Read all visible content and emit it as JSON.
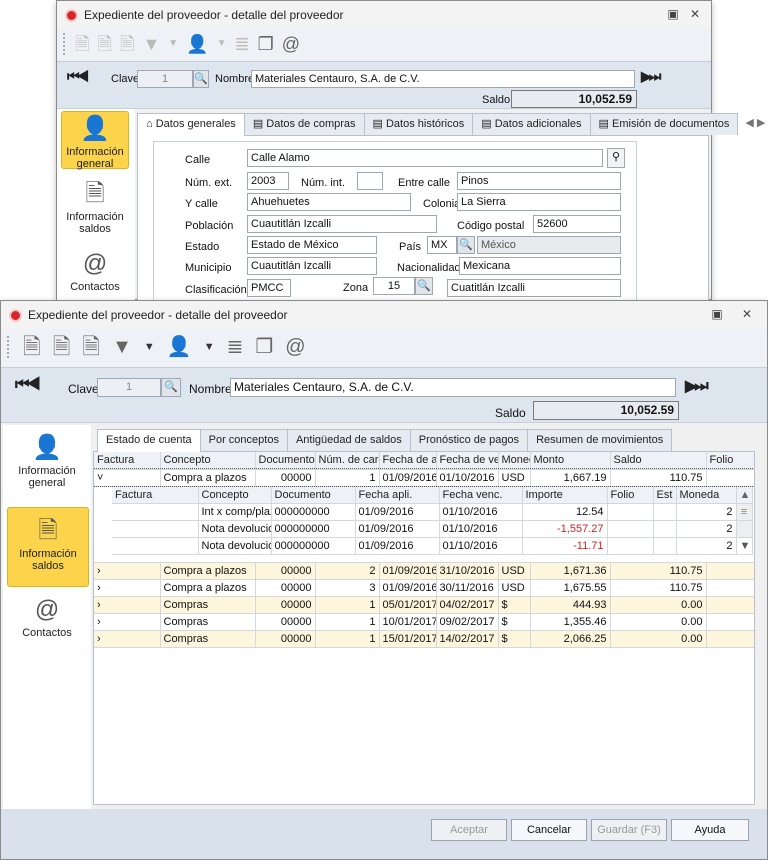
{
  "back_window": {
    "title": "Expediente del proveedor - detalle del proveedor",
    "clave_label": "Clave",
    "clave_value": "1",
    "nombre_label": "Nombre",
    "nombre_value": "Materiales Centauro, S.A. de C.V.",
    "saldo_label": "Saldo",
    "saldo_value": "10,052.59",
    "sidebar": [
      "Información general",
      "Información saldos",
      "Contactos"
    ],
    "tabs": [
      "Datos generales",
      "Datos de compras",
      "Datos históricos",
      "Datos adicionales",
      "Emisión de documentos"
    ],
    "form": {
      "calle_label": "Calle",
      "calle": "Calle Alamo",
      "num_ext_label": "Núm. ext.",
      "num_ext": "2003",
      "num_int_label": "Núm. int.",
      "num_int": "",
      "entre_calle_label": "Entre calle",
      "entre_calle": "Pinos",
      "y_calle_label": "Y calle",
      "y_calle": "Ahuehuetes",
      "colonia_label": "Colonia",
      "colonia": "La Sierra",
      "poblacion_label": "Población",
      "poblacion": "Cuautitlán Izcalli",
      "cp_label": "Código postal",
      "cp": "52600",
      "estado_label": "Estado",
      "estado": "Estado de México",
      "pais_label": "País",
      "pais_code": "MX",
      "pais_name": "México",
      "municipio_label": "Municipio",
      "municipio": "Cuautitlán Izcalli",
      "nacionalidad_label": "Nacionalidad",
      "nacionalidad": "Mexicana",
      "clasificacion_label": "Clasificación",
      "clasificacion": "PMCC",
      "zona_label": "Zona",
      "zona": "15",
      "zona_name": "Cuatitlán Izcalli"
    }
  },
  "main_window": {
    "title": "Expediente del proveedor - detalle del proveedor",
    "clave_label": "Clave",
    "clave_value": "1",
    "nombre_label": "Nombre",
    "nombre_value": "Materiales Centauro, S.A. de C.V.",
    "saldo_label": "Saldo",
    "saldo_value": "10,052.59",
    "sidebar": [
      "Información general",
      "Información saldos",
      "Contactos"
    ],
    "tabs": [
      "Estado de cuenta",
      "Por conceptos",
      "Antigüedad de saldos",
      "Pronóstico de pagos",
      "Resumen de movimientos"
    ],
    "columns": [
      "Factura",
      "Concepto",
      "Documento",
      "Núm. de carg",
      "Fecha de ap",
      "Fecha de ve",
      "Moneda",
      "Monto",
      "Saldo",
      "Folio"
    ],
    "expanded_row": {
      "concepto": "Compra a plazos",
      "documento": "00000",
      "num": "1",
      "fecha_ap": "01/09/2016",
      "fecha_ve": "01/10/2016",
      "moneda": "USD",
      "monto": "1,667.19",
      "saldo": "110.75"
    },
    "sub_columns": [
      "Factura",
      "Concepto",
      "Documento",
      "Fecha apli.",
      "Fecha venc.",
      "Importe",
      "Folio",
      "Est",
      "Moneda"
    ],
    "sub_rows": [
      {
        "concepto": "Int x comp/plaz",
        "documento": "000000000",
        "fecha_apli": "01/09/2016",
        "fecha_venc": "01/10/2016",
        "importe": "12.54",
        "moneda": "2"
      },
      {
        "concepto": "Nota devolució",
        "documento": "000000000",
        "fecha_apli": "01/09/2016",
        "fecha_venc": "01/10/2016",
        "importe": "-1,557.27",
        "moneda": "2"
      },
      {
        "concepto": "Nota devolució",
        "documento": "000000000",
        "fecha_apli": "01/09/2016",
        "fecha_venc": "01/10/2016",
        "importe": "-11.71",
        "moneda": "2"
      }
    ],
    "rows": [
      {
        "concepto": "Compra a plazos",
        "documento": "00000",
        "num": "2",
        "fecha_ap": "01/09/2016",
        "fecha_ve": "31/10/2016",
        "moneda": "USD",
        "monto": "1,671.36",
        "saldo": "110.75"
      },
      {
        "concepto": "Compra a plazos",
        "documento": "00000",
        "num": "3",
        "fecha_ap": "01/09/2016",
        "fecha_ve": "30/11/2016",
        "moneda": "USD",
        "monto": "1,675.55",
        "saldo": "110.75"
      },
      {
        "concepto": "Compras",
        "documento": "00000",
        "num": "1",
        "fecha_ap": "05/01/2017",
        "fecha_ve": "04/02/2017",
        "moneda": "$",
        "monto": "444.93",
        "saldo": "0.00"
      },
      {
        "concepto": "Compras",
        "documento": "00000",
        "num": "1",
        "fecha_ap": "10/01/2017",
        "fecha_ve": "09/02/2017",
        "moneda": "$",
        "monto": "1,355.46",
        "saldo": "0.00"
      },
      {
        "concepto": "Compras",
        "documento": "00000",
        "num": "1",
        "fecha_ap": "15/01/2017",
        "fecha_ve": "14/02/2017",
        "moneda": "$",
        "monto": "2,066.25",
        "saldo": "0.00"
      }
    ],
    "buttons": {
      "aceptar": "Aceptar",
      "cancelar": "Cancelar",
      "guardar": "Guardar (F3)",
      "ayuda": "Ayuda"
    },
    "colors": {
      "active_sidebar": "#fbd44c",
      "negative": "#d42020",
      "row_alt": "#fdf6dc"
    }
  }
}
